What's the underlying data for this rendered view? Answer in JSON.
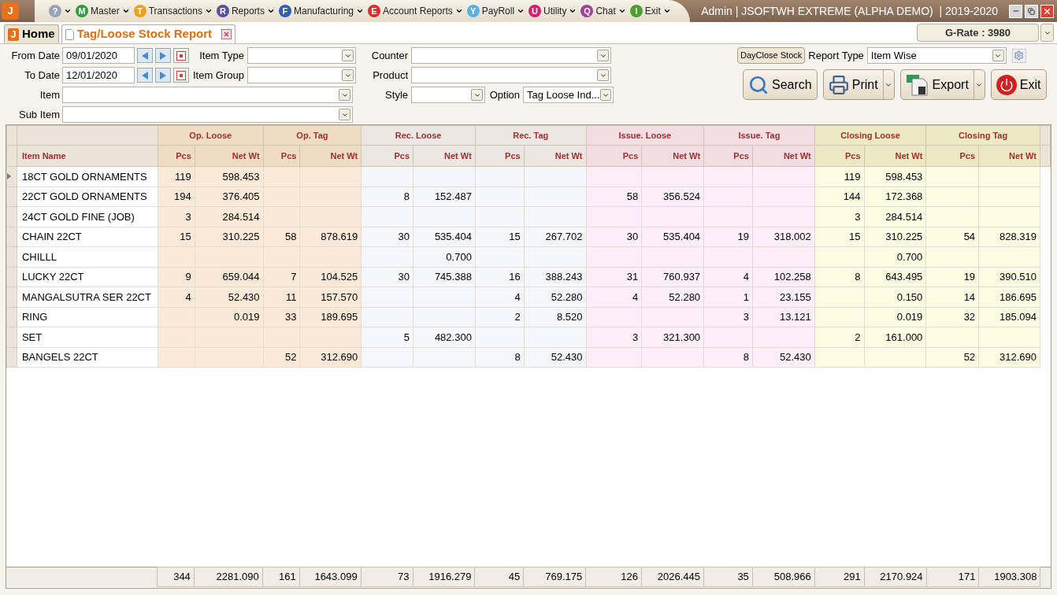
{
  "menu_bar": {
    "app_badge": "J",
    "items": [
      {
        "badge": "?",
        "color": "#9aa3b8"
      },
      {
        "badge": "M",
        "label": "Master",
        "color": "#2e9e3e"
      },
      {
        "badge": "T",
        "label": "Transactions",
        "color": "#f0a020"
      },
      {
        "badge": "R",
        "label": "Reports",
        "color": "#5a4fa0"
      },
      {
        "badge": "F",
        "label": "Manufacturing",
        "color": "#2f5fb0"
      },
      {
        "badge": "E",
        "label": "Account Reports",
        "color": "#d83030"
      },
      {
        "badge": "Y",
        "label": "PayRoll",
        "color": "#5ab0e0"
      },
      {
        "badge": "U",
        "label": "Utility",
        "color": "#d02070"
      },
      {
        "badge": "Q",
        "label": "Chat",
        "color": "#a040a0"
      },
      {
        "badge": "I",
        "label": "Exit",
        "color": "#50a030"
      }
    ],
    "title": "Admin | JSOFTWH EXTREME (ALPHA DEMO)  | 2019-2020"
  },
  "tabs": [
    {
      "badge": "J",
      "label": "Home",
      "selected": false,
      "closable": false
    },
    {
      "label": "Tag/Loose Stock Report",
      "selected": true,
      "closable": true
    }
  ],
  "g_rate": "G-Rate : 3980",
  "filters": {
    "from_date": {
      "label": "From Date",
      "value": "09/01/2020"
    },
    "to_date": {
      "label": "To Date",
      "value": "12/01/2020"
    },
    "item_type": {
      "label": "Item Type"
    },
    "item_group": {
      "label": "Item Group"
    },
    "item": {
      "label": "Item"
    },
    "sub_item": {
      "label": "Sub Item"
    },
    "counter": {
      "label": "Counter"
    },
    "product": {
      "label": "Product"
    },
    "style": {
      "label": "Style"
    },
    "option": {
      "label": "Option",
      "value": "Tag Loose Ind..."
    },
    "report_type": {
      "label": "Report Type",
      "value": "Item Wise"
    }
  },
  "day_close_button": "DayClose Stock",
  "actions": [
    {
      "kind": "search",
      "label": "Search",
      "split": false
    },
    {
      "kind": "print",
      "label": "Print",
      "split": true
    },
    {
      "kind": "export",
      "label": "Export",
      "split": true
    },
    {
      "kind": "exit",
      "label": "Exit",
      "split": false
    }
  ],
  "grid": {
    "item_column": "Item Name",
    "groups": [
      {
        "label": "Op. Loose",
        "sub": [
          "Pcs",
          "Net Wt"
        ]
      },
      {
        "label": "Op. Tag",
        "sub": [
          "Pcs",
          "Net Wt"
        ]
      },
      {
        "label": "Rec. Loose",
        "sub": [
          "Pcs",
          "Net Wt"
        ]
      },
      {
        "label": "Rec. Tag",
        "sub": [
          "Pcs",
          "Net Wt"
        ]
      },
      {
        "label": "Issue. Loose",
        "sub": [
          "Pcs",
          "Net Wt"
        ]
      },
      {
        "label": "Issue. Tag",
        "sub": [
          "Pcs",
          "Net Wt"
        ]
      },
      {
        "label": "Closing Loose",
        "sub": [
          "Pcs",
          "Net Wt"
        ]
      },
      {
        "label": "Closing Tag",
        "sub": [
          "Pcs",
          "Net Wt"
        ]
      }
    ],
    "rows": [
      {
        "name": "18CT GOLD ORNAMENTS",
        "selected": true,
        "cells": [
          "119",
          "598.453",
          null,
          null,
          null,
          null,
          null,
          null,
          null,
          null,
          null,
          null,
          "119",
          "598.453",
          null,
          null
        ]
      },
      {
        "name": "22CT GOLD ORNAMENTS",
        "selected": false,
        "cells": [
          "194",
          "376.405",
          null,
          null,
          "8",
          "152.487",
          null,
          null,
          "58",
          "356.524",
          null,
          null,
          "144",
          "172.368",
          null,
          null
        ]
      },
      {
        "name": "24CT GOLD FINE (JOB)",
        "selected": false,
        "cells": [
          "3",
          "284.514",
          null,
          null,
          null,
          null,
          null,
          null,
          null,
          null,
          null,
          null,
          "3",
          "284.514",
          null,
          null
        ]
      },
      {
        "name": "CHAIN 22CT",
        "selected": false,
        "cells": [
          "15",
          "310.225",
          "58",
          "878.619",
          "30",
          "535.404",
          "15",
          "267.702",
          "30",
          "535.404",
          "19",
          "318.002",
          "15",
          "310.225",
          "54",
          "828.319"
        ]
      },
      {
        "name": "CHILLL",
        "selected": false,
        "cells": [
          null,
          null,
          null,
          null,
          null,
          "0.700",
          null,
          null,
          null,
          null,
          null,
          null,
          null,
          "0.700",
          null,
          null
        ]
      },
      {
        "name": "LUCKY 22CT",
        "selected": false,
        "cells": [
          "9",
          "659.044",
          "7",
          "104.525",
          "30",
          "745.388",
          "16",
          "388.243",
          "31",
          "760.937",
          "4",
          "102.258",
          "8",
          "643.495",
          "19",
          "390.510"
        ]
      },
      {
        "name": "MANGALSUTRA SER 22CT",
        "selected": false,
        "cells": [
          "4",
          "52.430",
          "11",
          "157.570",
          null,
          null,
          "4",
          "52.280",
          "4",
          "52.280",
          "1",
          "23.155",
          null,
          "0.150",
          "14",
          "186.695"
        ]
      },
      {
        "name": "RING",
        "selected": false,
        "cells": [
          null,
          "0.019",
          "33",
          "189.695",
          null,
          null,
          "2",
          "8.520",
          null,
          null,
          "3",
          "13.121",
          null,
          "0.019",
          "32",
          "185.094"
        ]
      },
      {
        "name": "SET",
        "selected": false,
        "cells": [
          null,
          null,
          null,
          null,
          "5",
          "482.300",
          null,
          null,
          "3",
          "321.300",
          null,
          null,
          "2",
          "161.000",
          null,
          null
        ]
      },
      {
        "name": "BANGELS 22CT",
        "selected": false,
        "cells": [
          null,
          null,
          "52",
          "312.690",
          null,
          null,
          "8",
          "52.430",
          null,
          null,
          "8",
          "52.430",
          null,
          null,
          "52",
          "312.690"
        ]
      }
    ],
    "totals": [
      "344",
      "2281.090",
      "161",
      "1643.099",
      "73",
      "1916.279",
      "45",
      "769.175",
      "126",
      "2026.445",
      "35",
      "508.966",
      "291",
      "2170.924",
      "171",
      "1903.308"
    ]
  }
}
